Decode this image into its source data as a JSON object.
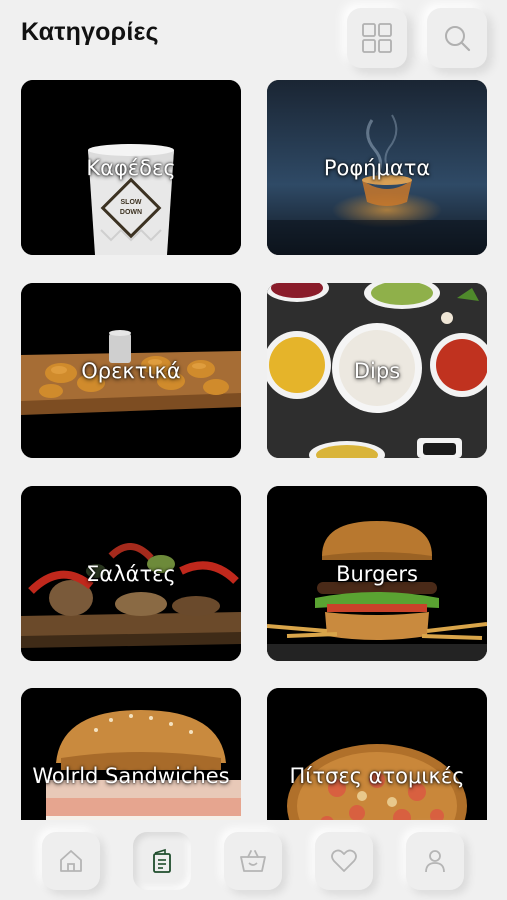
{
  "header": {
    "title": "Κατηγορίες",
    "grid_icon": "grid-icon",
    "search_icon": "search-icon"
  },
  "categories": [
    {
      "label": "Καφέδες",
      "image": "coffee-cup"
    },
    {
      "label": "Ροφήματα",
      "image": "tea-cup"
    },
    {
      "label": "Ορεκτικά",
      "image": "fried-appetizers"
    },
    {
      "label": "Dips",
      "image": "dip-bowls"
    },
    {
      "label": "Σαλάτες",
      "image": "salad"
    },
    {
      "label": "Burgers",
      "image": "burger"
    },
    {
      "label": "Wolrld Sandwiches",
      "image": "sandwich"
    },
    {
      "label": "Πίτσες ατομικές",
      "image": "pizza"
    }
  ],
  "coffee_cup_text": [
    "SLOW",
    "DOWN"
  ],
  "bottom_nav": [
    {
      "icon": "home-icon",
      "active": false
    },
    {
      "icon": "menu-icon",
      "active": true
    },
    {
      "icon": "basket-icon",
      "active": false
    },
    {
      "icon": "heart-icon",
      "active": false
    },
    {
      "icon": "user-icon",
      "active": false
    }
  ],
  "colors": {
    "background": "#f0f0f0",
    "card_bg": "#000000",
    "active_icon": "#1f4d2c",
    "inactive_icon": "#b5b5b5"
  }
}
